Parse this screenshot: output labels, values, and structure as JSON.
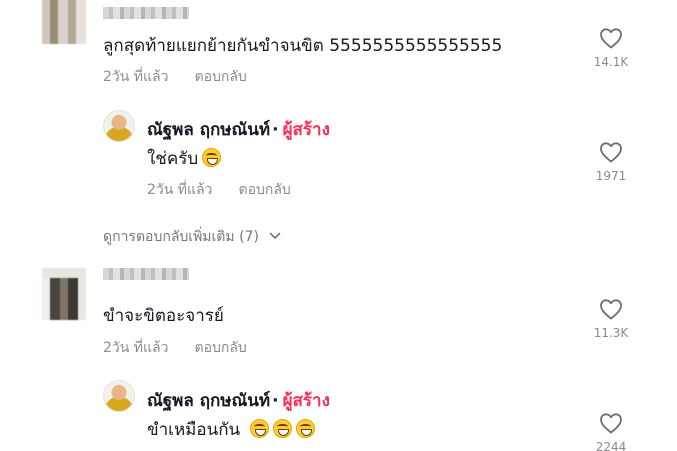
{
  "comments": [
    {
      "text": "ลูกสุดท้ายแยกย้ายกันขำจนขิต 5555555555555555",
      "age": "2วัน ที่แล้ว",
      "reply_label": "ตอบกลับ",
      "likes": "14.1K",
      "reply": {
        "author": "ณัฐพล ฤกษณันท์",
        "dot": "·",
        "badge": "ผู้สร้าง",
        "text": "ใช่ครับ",
        "emoji_count": 1,
        "age": "2วัน ที่แล้ว",
        "reply_label": "ตอบกลับ",
        "likes": "1971"
      },
      "view_more": "ดูการตอบกลับเพิ่มเติม (7)"
    },
    {
      "text": "ขำจะขิตอะจารย์",
      "age": "2วัน ที่แล้ว",
      "reply_label": "ตอบกลับ",
      "likes": "11.3K",
      "reply": {
        "author": "ณัฐพล ฤกษณันท์",
        "dot": "·",
        "badge": "ผู้สร้าง",
        "text": "ขำเหมือนกัน",
        "emoji_count": 3,
        "likes": "2244"
      }
    }
  ],
  "icons": {
    "like": "heart-outline-icon",
    "expand": "chevron-down-icon",
    "emoji": "grinning-face-with-smiling-eyes-emoji"
  },
  "colors": {
    "text": "#161823",
    "muted": "#8a8b91",
    "creator_badge": "#fe2c55"
  }
}
